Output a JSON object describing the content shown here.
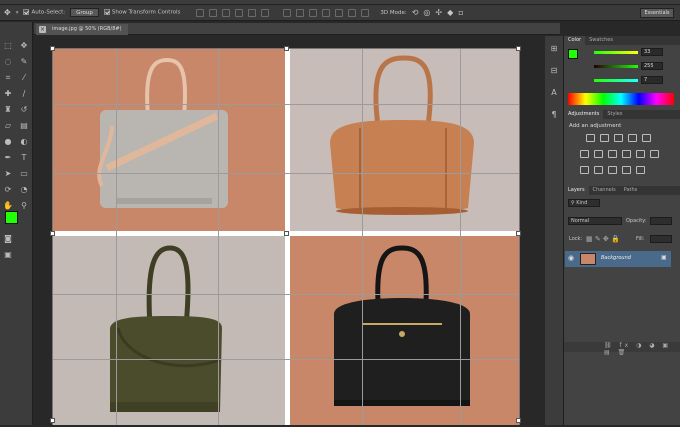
{
  "options_bar": {
    "auto_select_label": "Auto-Select:",
    "auto_select_value": "Group",
    "show_transform_label": "Show Transform Controls",
    "mode_3d_label": "3D Mode:",
    "workspace": "Essentials"
  },
  "document": {
    "tab_title": "image.jpg @ 50% (RGB/8#)",
    "grid_items": [
      {
        "name": "grey-tote-bag",
        "bg": "#c9876a",
        "bag_color": "#b9b6b1"
      },
      {
        "name": "tan-duffel-bag",
        "bg": "#c7bcb7",
        "bag_color": "#c78052"
      },
      {
        "name": "olive-duffel-bag",
        "bg": "#c4bab5",
        "bag_color": "#4b4c2c"
      },
      {
        "name": "black-doctor-bag",
        "bg": "#c9876a",
        "bag_color": "#1f1f1f"
      }
    ]
  },
  "color_panel": {
    "tabs": [
      "Color",
      "Swatches"
    ],
    "values": [
      "33",
      "255",
      "7"
    ],
    "foreground": "#21ff07",
    "background": "#ffffff"
  },
  "adjustments_panel": {
    "tabs": [
      "Adjustments",
      "Styles"
    ],
    "heading": "Add an adjustment"
  },
  "layers_panel": {
    "tabs": [
      "Layers",
      "Channels",
      "Paths"
    ],
    "kind_label": "Kind",
    "blend_mode": "Normal",
    "opacity_label": "Opacity:",
    "lock_label": "Lock:",
    "fill_label": "Fill:",
    "layer_name": "Background"
  }
}
